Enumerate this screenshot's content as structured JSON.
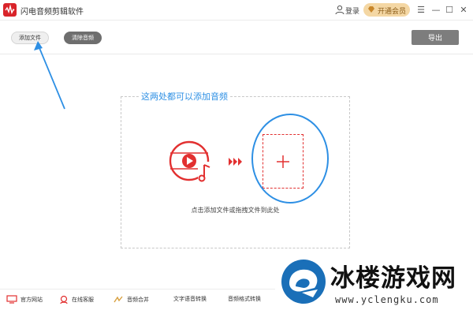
{
  "window": {
    "title": "闪电音频剪辑软件",
    "login_label": "登录",
    "vip_label": "开通会员",
    "controls": [
      "☰",
      "—",
      "☐",
      "✕"
    ]
  },
  "toolbar": {
    "add_file_label": "添加文件",
    "clear_label": "清除音频",
    "export_label": "导出"
  },
  "dropzone": {
    "annotation": "这两处都可以添加音频",
    "hint": "点击添加文件或拖拽文件到此处"
  },
  "bottom_bar": {
    "items": [
      "官方网站",
      "在线客服",
      "音频合并",
      "文字语音转换",
      "音频格式转换"
    ]
  },
  "watermark": {
    "title": "冰楼游戏网",
    "url": "www.yclengku.com"
  },
  "colors": {
    "brand_red": "#d9242a",
    "annotation_blue": "#2d8fe4",
    "vip_gold": "#f4d7a4"
  }
}
